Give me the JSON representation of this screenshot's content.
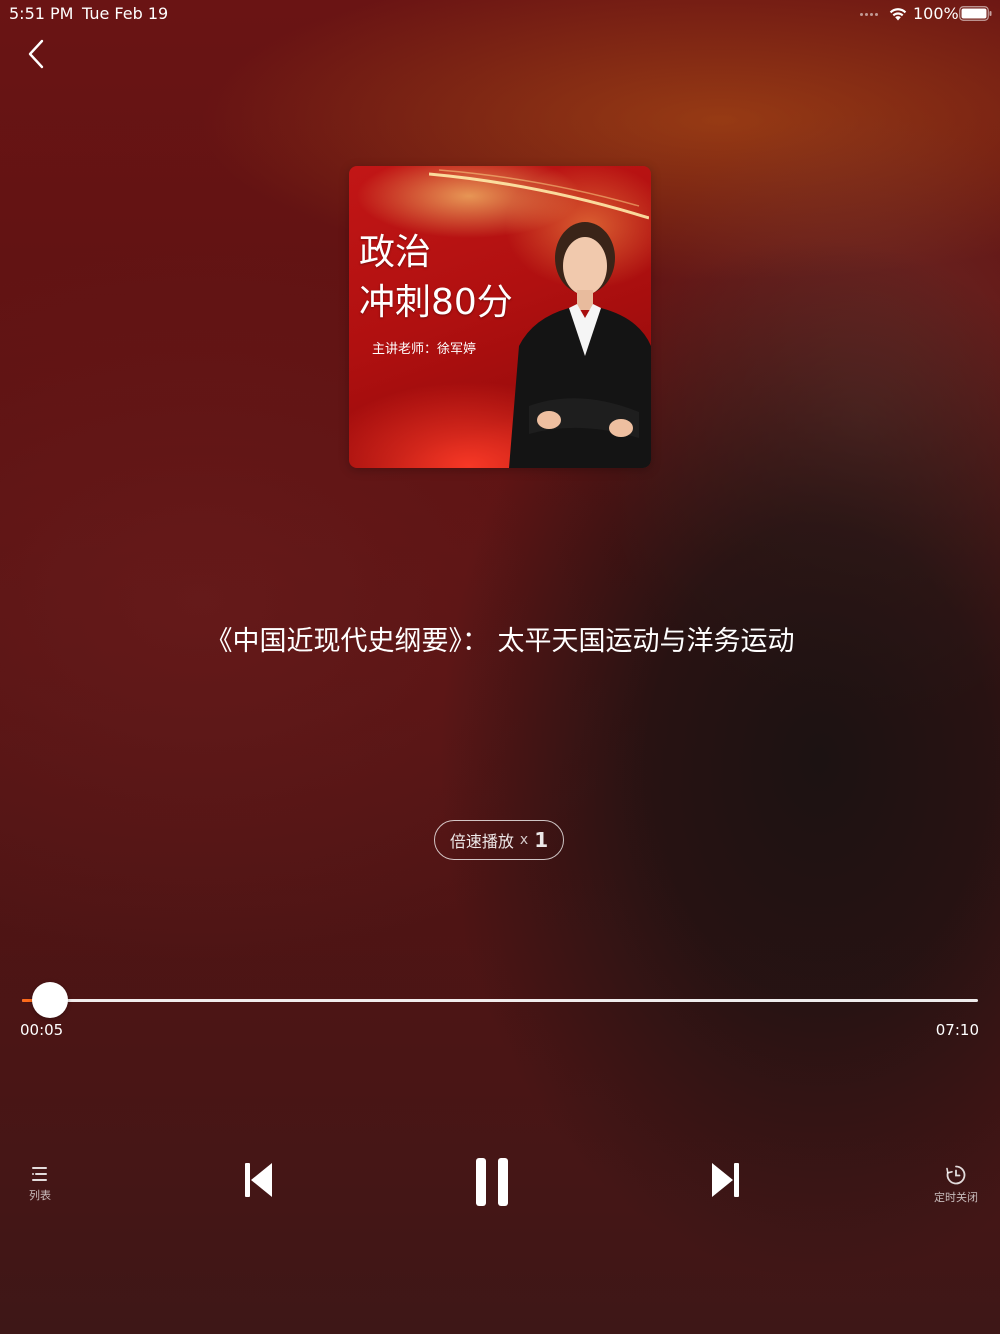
{
  "status_bar": {
    "time": "5:51 PM",
    "date": "Tue Feb 19",
    "battery": "100%",
    "icons": [
      "signal-dots-icon",
      "wifi-icon",
      "battery-icon"
    ]
  },
  "nav": {
    "back_icon": "chevron-left-icon"
  },
  "cover": {
    "title_line1": "政治",
    "title_line2": "冲刺80分",
    "teacher": "主讲老师：徐军婷"
  },
  "track": {
    "title": "《中国近现代史纲要》： 太平天国运动与洋务运动"
  },
  "speed": {
    "label": "倍速播放",
    "x": "x",
    "value": "1"
  },
  "progress": {
    "elapsed": "00:05",
    "total": "07:10",
    "fraction": 0.029
  },
  "controls": {
    "playlist_label": "列表",
    "timer_label": "定时关闭",
    "icons": [
      "playlist-icon",
      "skip-previous-icon",
      "pause-icon",
      "skip-next-icon",
      "timer-icon"
    ]
  },
  "colors": {
    "accent": "#ff6a1a",
    "background": "#5c1212",
    "foreground": "#ffffff"
  }
}
